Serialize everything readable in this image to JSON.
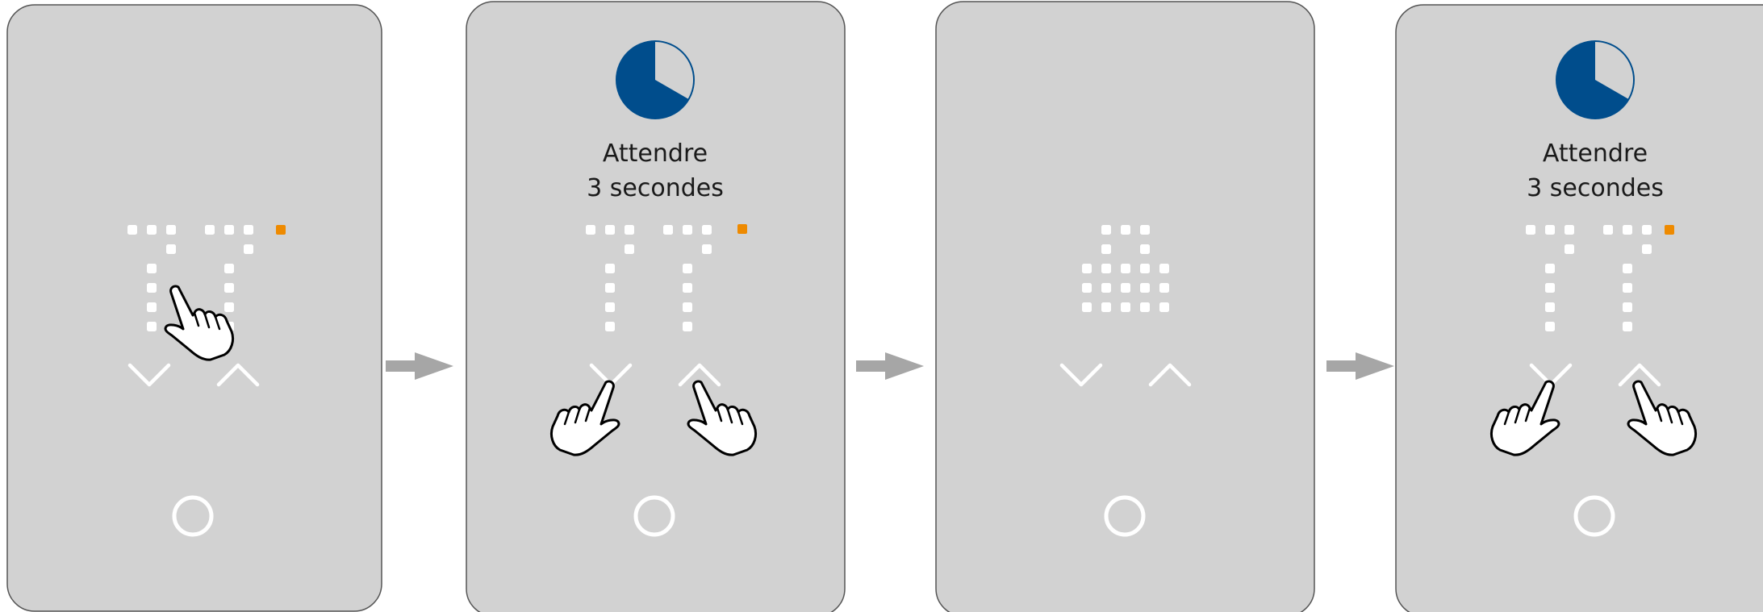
{
  "panels": [
    {
      "step": 1,
      "display": "77",
      "indicator_color": "#ee8a00",
      "timer": null,
      "hands": [
        "single-tap-display"
      ]
    },
    {
      "step": 2,
      "display": "77",
      "indicator_color": "#ee8a00",
      "timer": {
        "caption_line1": "Attendre",
        "caption_line2": "3 secondes"
      },
      "hands": [
        "left-hand-on-down",
        "right-hand-on-up"
      ]
    },
    {
      "step": 3,
      "display": "lock",
      "indicator_color": null,
      "timer": null,
      "hands": []
    },
    {
      "step": 4,
      "display": "77",
      "indicator_color": "#ee8a00",
      "timer": {
        "caption_line1": "Attendre",
        "caption_line2": "3 secondes"
      },
      "hands": [
        "left-hand-on-down",
        "right-hand-on-up"
      ]
    }
  ],
  "colors": {
    "panel_fill": "#d2d2d2",
    "panel_border": "#555555",
    "glyph": "#ffffff",
    "timer_fill": "#004d8c",
    "arrow": "#a6a6a6",
    "indicator": "#ee8a00"
  }
}
